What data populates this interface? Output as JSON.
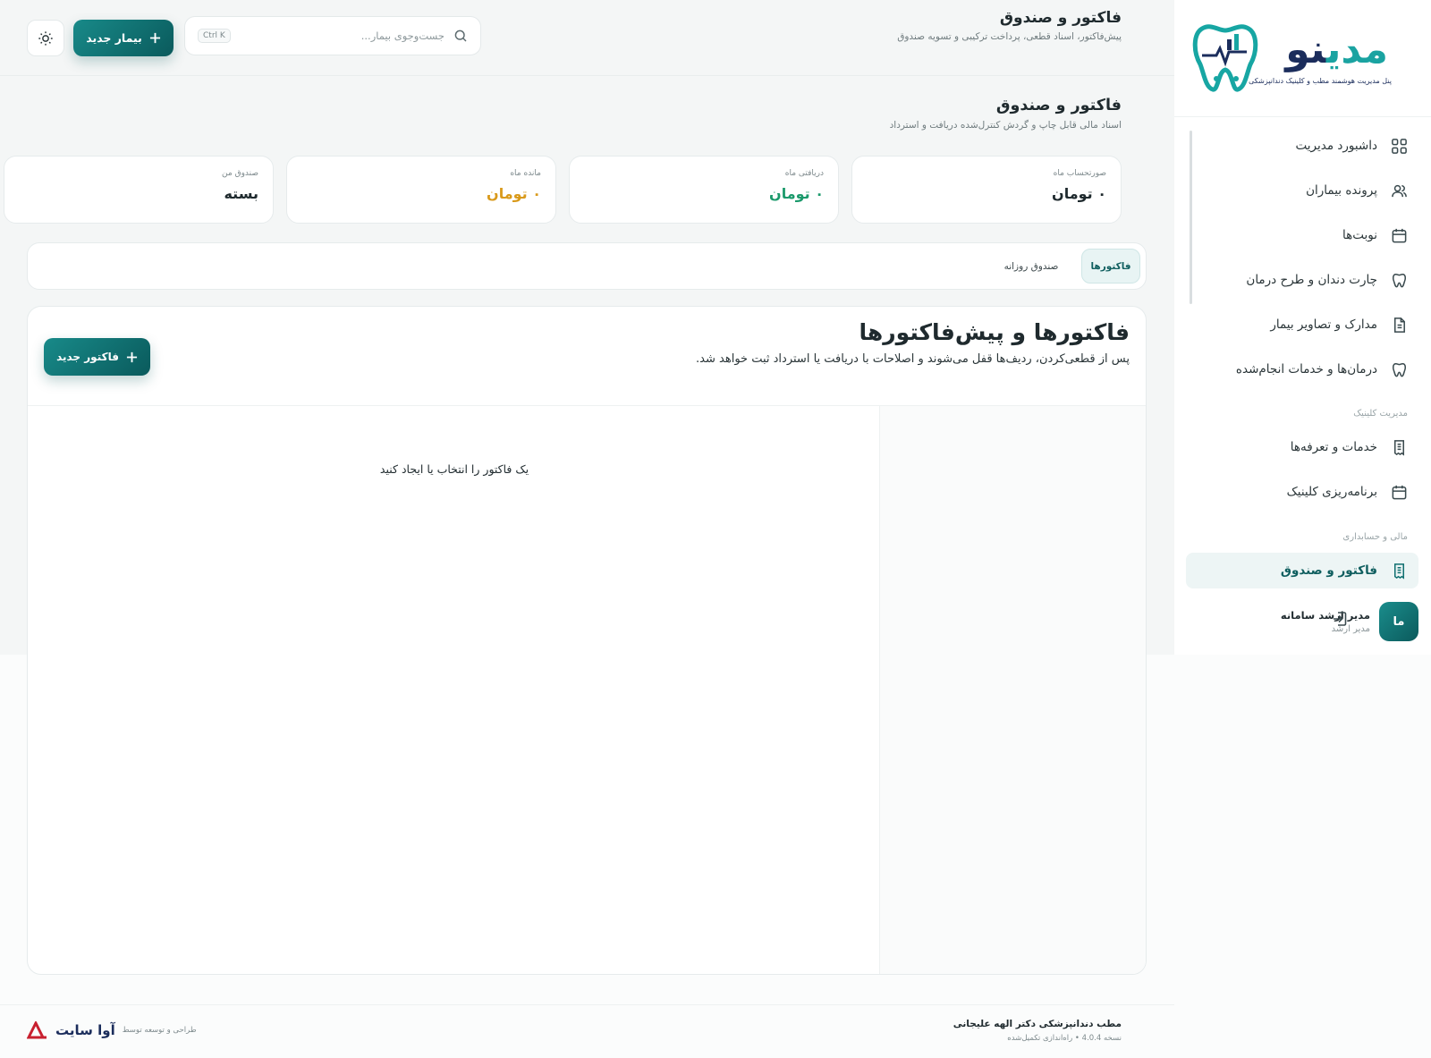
{
  "brand": {
    "name_part1": "مدی",
    "name_part2": "نو",
    "tagline": "پنل مدیریت هوشمند مطب و کلینیک دندانپزشکی"
  },
  "sidebar": {
    "items": [
      {
        "label": "داشبورد مدیریت",
        "icon": "grid-icon"
      },
      {
        "label": "پرونده بیماران",
        "icon": "users-icon"
      },
      {
        "label": "نوبت‌ها",
        "icon": "calendar-icon"
      },
      {
        "label": "چارت دندان و طرح درمان",
        "icon": "tooth-icon"
      },
      {
        "label": "مدارک و تصاویر بیمار",
        "icon": "document-icon"
      },
      {
        "label": "درمان‌ها و خدمات انجام‌شده",
        "icon": "tooth-icon"
      }
    ],
    "section_clinic": "مدیریت کلینیک",
    "clinic_items": [
      {
        "label": "خدمات و تعرفه‌ها",
        "icon": "receipt-icon"
      },
      {
        "label": "برنامه‌ریزی کلینیک",
        "icon": "calendar-icon"
      }
    ],
    "section_finance": "مالی و حسابداری",
    "finance_items": [
      {
        "label": "فاکتور و صندوق",
        "icon": "receipt-icon",
        "active": true
      }
    ],
    "user": {
      "initials": "ما",
      "name": "مدیر ارشد سامانه",
      "role": "مدیر ارشد"
    }
  },
  "topbar": {
    "title": "فاکتور و صندوق",
    "subtitle": "پیش‌فاکتور، اسناد قطعی، پرداخت ترکیبی و تسویه صندوق",
    "search_placeholder": "جست‌وجوی بیمار...",
    "shortcut": "Ctrl K",
    "new_patient": "بیمار جدید"
  },
  "page": {
    "title": "فاکتور و صندوق",
    "subtitle": "اسناد مالی قابل چاپ و گردش کنترل‌شده دریافت و استرداد"
  },
  "stats": [
    {
      "label": "صورتحساب ماه",
      "value": "۰ تومان",
      "color": "#1f2a2e"
    },
    {
      "label": "دریافتی ماه",
      "value": "۰ تومان",
      "color": "#1c9a6c"
    },
    {
      "label": "مانده ماه",
      "value": "۰ تومان",
      "color": "#d99a1c"
    },
    {
      "label": "صندوق من",
      "value": "بسته",
      "color": "#1f2a2e"
    }
  ],
  "tabs": {
    "active": "فاکتورها",
    "other": "صندوق روزانه"
  },
  "invoices": {
    "title": "فاکتورها و پیش‌فاکتورها",
    "subtitle": "پس از قطعی‌کردن، ردیف‌ها قفل می‌شوند و اصلاحات با دریافت یا استرداد ثبت خواهد شد.",
    "new_button": "فاکتور جدید",
    "empty_message": "یک فاکتور را انتخاب یا ایجاد کنید"
  },
  "footer": {
    "clinic": "مطب دندانپزشکی دکتر الهه علیجانی",
    "version": "نسخه 4.0.4 • راه‌اندازی تکمیل‌شده",
    "designed_by": "طراحی و توسعه توسط",
    "company": "آوا سایت"
  },
  "colors": {
    "accent": "#0f6f70",
    "accent_light": "#e8f4f4"
  }
}
